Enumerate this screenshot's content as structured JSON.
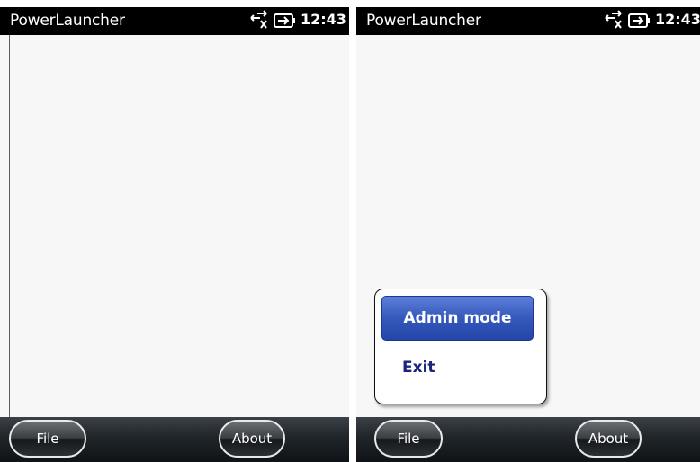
{
  "screens": [
    {
      "title": "PowerLauncher",
      "status": {
        "connectivity_icon": "connection-off-icon",
        "battery_icon": "battery-charging-icon",
        "time": "12:43"
      },
      "softkeys": {
        "left": "File",
        "right": "About"
      }
    },
    {
      "title": "PowerLauncher",
      "status": {
        "connectivity_icon": "connection-off-icon",
        "battery_icon": "battery-charging-icon",
        "time": "12:43"
      },
      "softkeys": {
        "left": "File",
        "right": "About"
      },
      "menu": {
        "items": [
          "Admin mode",
          "Exit"
        ],
        "highlighted": "Admin mode"
      }
    }
  ],
  "colors": {
    "titlebar": "#000000",
    "menu_highlight": "#3558bd",
    "menu_text": "#1a237e"
  }
}
